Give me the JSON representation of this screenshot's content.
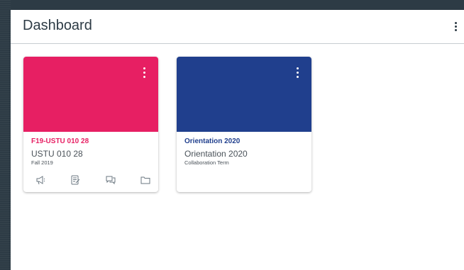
{
  "header": {
    "title": "Dashboard",
    "options_icon": "vertical-dots-icon"
  },
  "cards": [
    {
      "course_code": "F19-USTU 010 28",
      "course_name": "USTU 010 28",
      "term": "Fall 2019",
      "color": "#e71f63",
      "menu_icon": "vertical-dots-icon",
      "icons": [
        "announcements-icon",
        "assignments-icon",
        "discussions-icon",
        "files-icon"
      ]
    },
    {
      "course_code": "Orientation 2020",
      "course_name": "Orientation 2020",
      "term": "Collaboration Term",
      "color": "#203f8d",
      "menu_icon": "vertical-dots-icon",
      "icons": []
    }
  ],
  "colors": {
    "sidebar": "#2d3b45",
    "divider": "#c7cdd1",
    "text": "#2d3b45"
  }
}
